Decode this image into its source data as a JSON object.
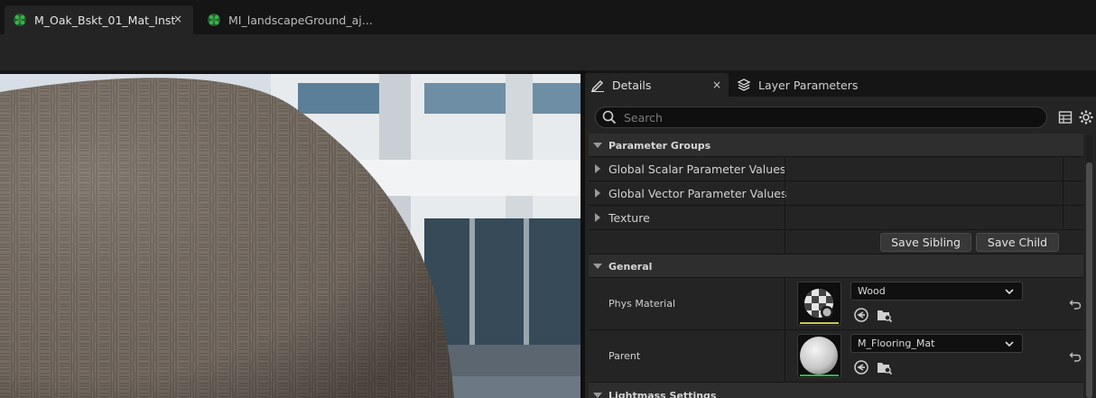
{
  "tabs": [
    {
      "label": "M_Oak_Bskt_01_Mat_Inst",
      "close": "×",
      "icon": "material-instance-icon"
    },
    {
      "label": "MI_landscapeGround_aj...",
      "icon": "material-instance-icon"
    }
  ],
  "details_panel": {
    "tabs": [
      {
        "label": "Details",
        "icon": "pencil-icon",
        "close": "×"
      },
      {
        "label": "Layer Parameters",
        "icon": "layers-icon"
      }
    ],
    "search": {
      "placeholder": "Search",
      "value": ""
    },
    "categories": {
      "parameter_groups": {
        "title": "Parameter Groups",
        "items": [
          "Global Scalar Parameter Values",
          "Global Vector Parameter Values",
          "Texture"
        ],
        "buttons": {
          "save_sibling": "Save Sibling",
          "save_child": "Save Child"
        }
      },
      "general": {
        "title": "General",
        "phys_material": {
          "label": "Phys Material",
          "value": "Wood",
          "bar_color": "#c8c84a"
        },
        "parent": {
          "label": "Parent",
          "value": "M_Flooring_Mat",
          "bar_color": "#36b24a"
        }
      },
      "lightmass": {
        "title": "Lightmass Settings"
      }
    }
  },
  "colors": {
    "panel_bg": "#242424",
    "category_bg": "#2e2e2e",
    "tab_strip_bg": "#151515",
    "material_icon_green": "#2e8b3a"
  }
}
